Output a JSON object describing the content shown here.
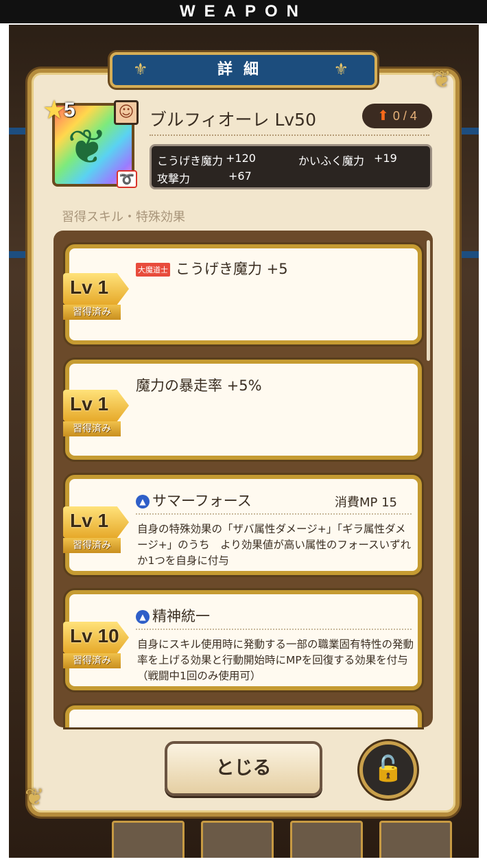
{
  "header": {
    "title": "WEAPON"
  },
  "panel": {
    "title": "詳細"
  },
  "weapon": {
    "rarity": "5",
    "name": "ブルフィオーレ Lv50",
    "upgrade": "0 / 4",
    "icon": "sword-icon",
    "stats": {
      "atk_magic_label": "こうげき魔力",
      "atk_magic_value": "+120",
      "heal_magic_label": "かいふく魔力",
      "heal_magic_value": "+19",
      "attack_label": "攻撃力",
      "attack_value": "+67"
    }
  },
  "section_label": "習得スキル・特殊効果",
  "skills": [
    {
      "lv": "Lv 1",
      "status": "習得済み",
      "tag": "大魔道士",
      "title": "こうげき魔力 +5"
    },
    {
      "lv": "Lv 1",
      "status": "習得済み",
      "title": "魔力の暴走率 +5%"
    },
    {
      "lv": "Lv 1",
      "status": "習得済み",
      "title": "サマーフォース",
      "mp": "消費MP 15",
      "desc": "自身の特殊効果の「ザバ属性ダメージ+」「ギラ属性ダメージ+」のうち　より効果値が高い属性のフォースいずれか1つを自身に付与"
    },
    {
      "lv": "Lv 10",
      "status": "習得済み",
      "title": "精神統一",
      "desc": "自身にスキル使用時に発動する一部の職業固有特性の発動率を上げる効果と行動開始時にMPを回復する効果を付与（戦闘中1回のみ使用可）"
    }
  ],
  "buttons": {
    "close": "とじる",
    "lock_icon": "unlock-icon"
  },
  "colors": {
    "banner": "#1c4d7d",
    "gold": "#c59b32",
    "panel": "#f2e6cd"
  }
}
